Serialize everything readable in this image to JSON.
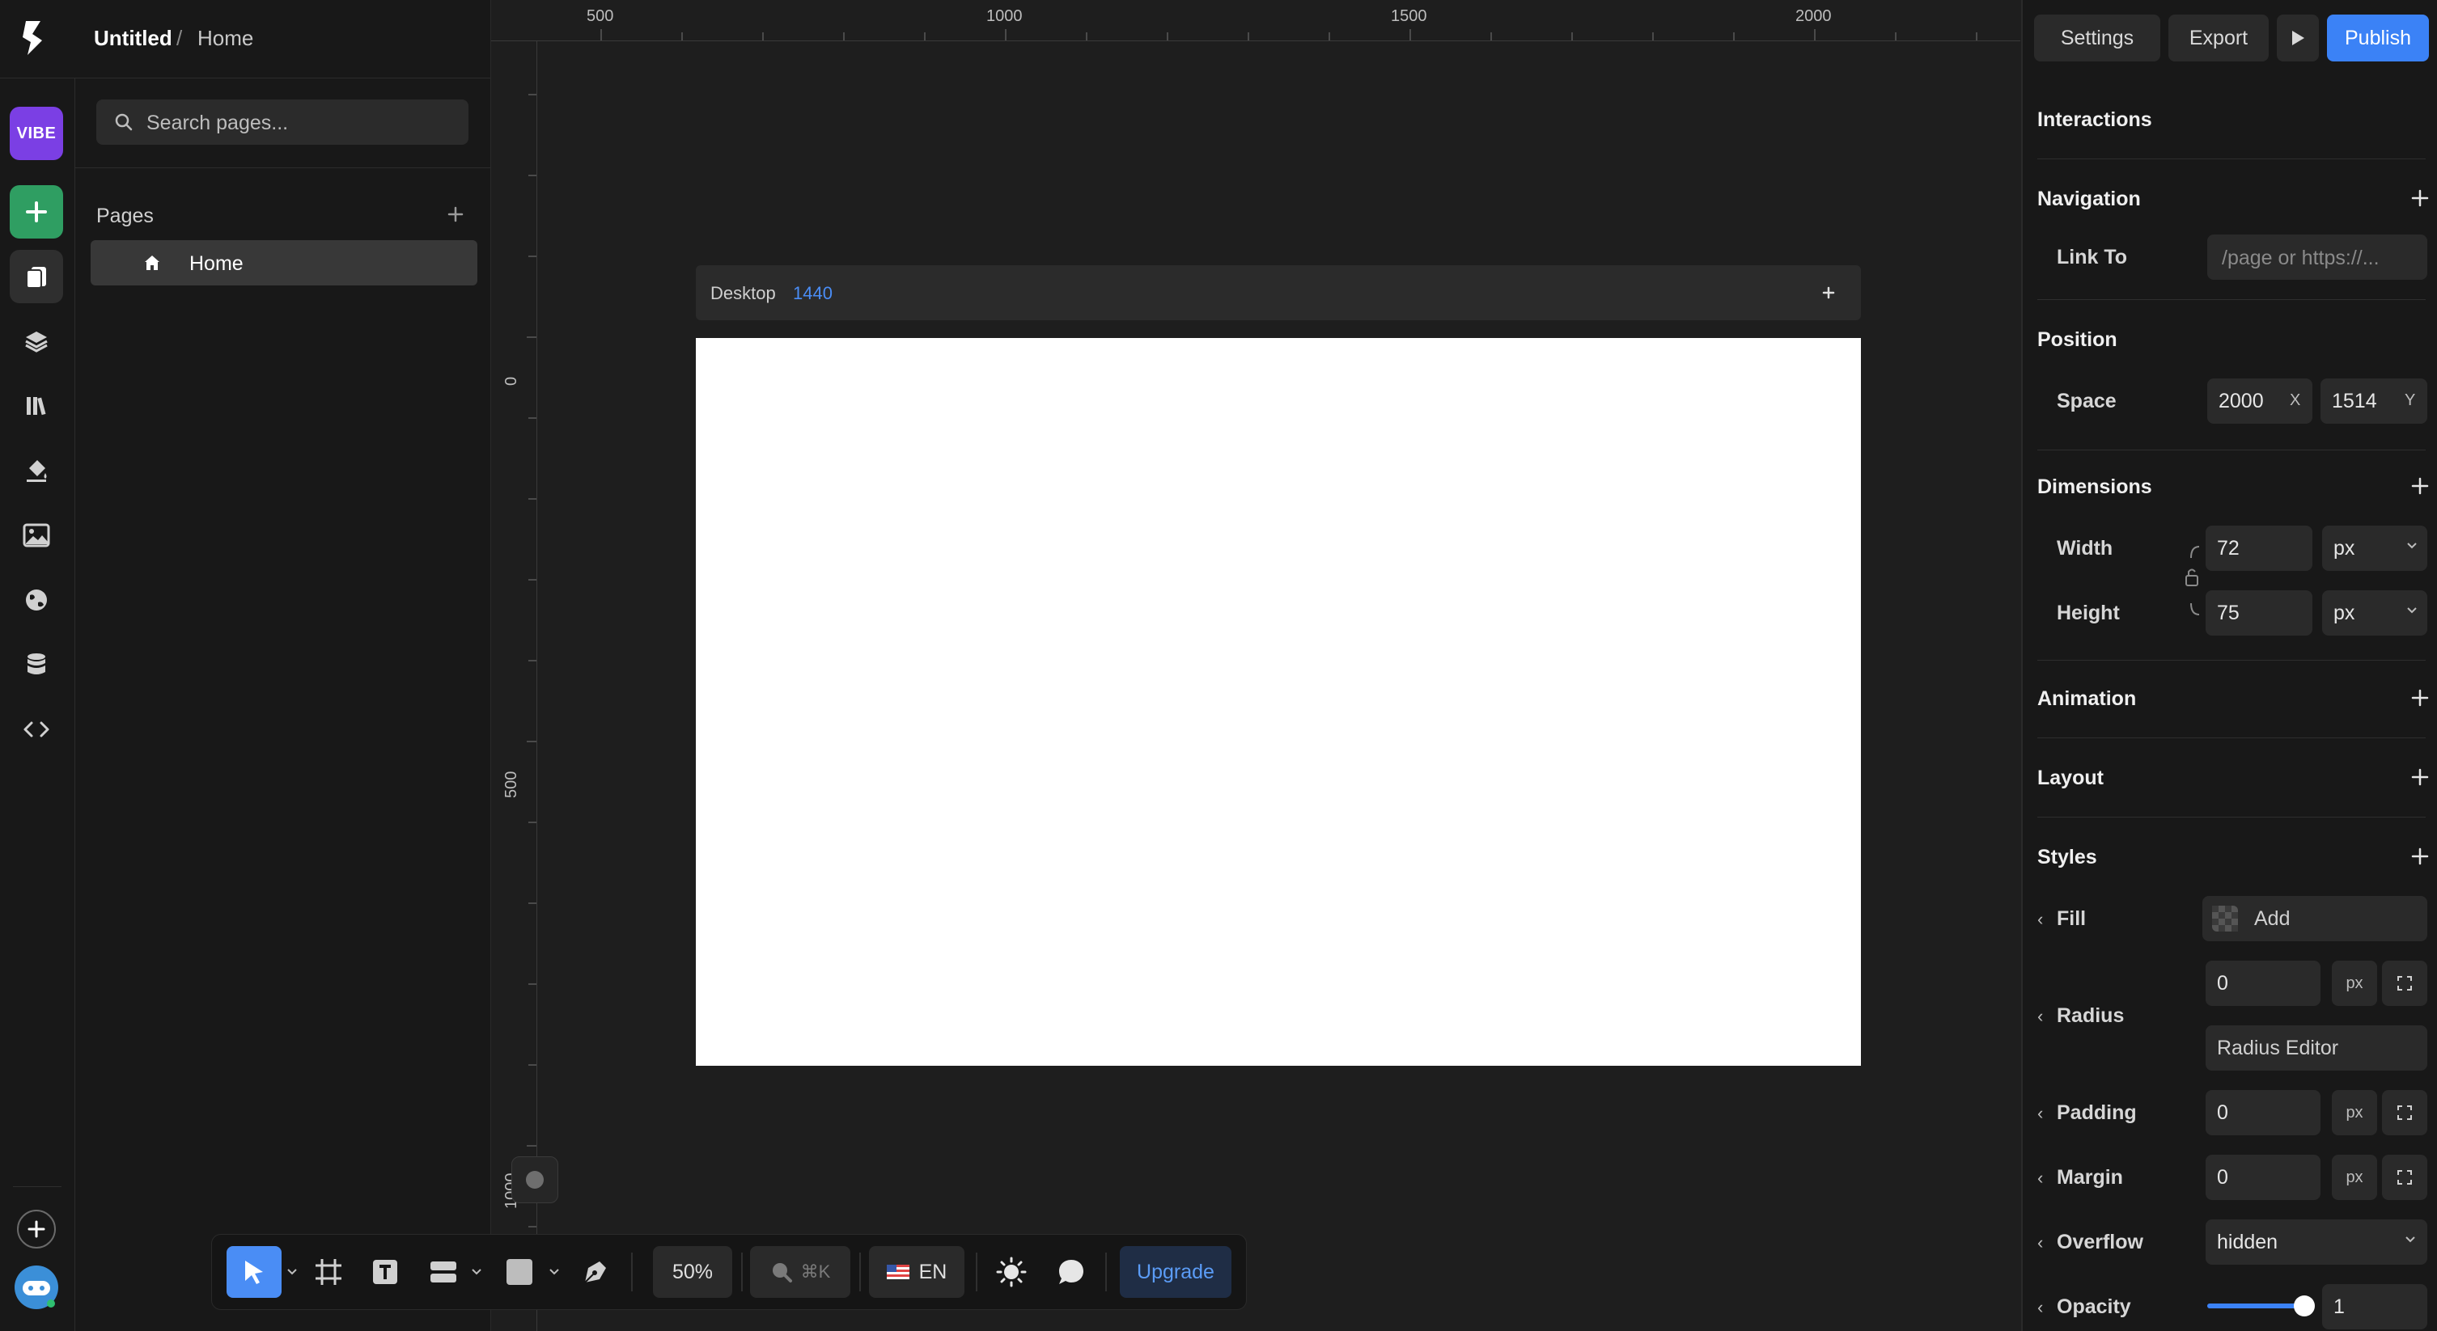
{
  "header": {
    "project_title": "Untitled",
    "separator": "/",
    "current_page": "Home"
  },
  "rail": {
    "vibe_label": "VIBE"
  },
  "pages_panel": {
    "search_placeholder": "Search pages...",
    "section_title": "Pages",
    "pages": [
      {
        "label": "Home"
      }
    ]
  },
  "canvas": {
    "ruler_top_labels": [
      "500",
      "1000",
      "1500",
      "2000"
    ],
    "ruler_left_labels": [
      "0",
      "500",
      "1000"
    ],
    "frame": {
      "device": "Desktop",
      "width": "1440"
    }
  },
  "toolbar": {
    "zoom": "50%",
    "search_shortcut": "⌘K",
    "language": "EN",
    "upgrade_label": "Upgrade"
  },
  "right_panel": {
    "top_buttons": {
      "settings": "Settings",
      "export": "Export",
      "publish": "Publish"
    },
    "interactions_title": "Interactions",
    "navigation": {
      "title": "Navigation",
      "link_label": "Link To",
      "link_placeholder": "/page or https://..."
    },
    "position": {
      "title": "Position",
      "space_label": "Space",
      "x_value": "2000",
      "x_suffix": "X",
      "y_value": "1514",
      "y_suffix": "Y"
    },
    "dimensions": {
      "title": "Dimensions",
      "width_label": "Width",
      "width_value": "72",
      "width_unit": "px",
      "height_label": "Height",
      "height_value": "75",
      "height_unit": "px"
    },
    "animation_title": "Animation",
    "layout_title": "Layout",
    "styles": {
      "title": "Styles",
      "fill_label": "Fill",
      "fill_value": "Add",
      "radius_label": "Radius",
      "radius_value": "0",
      "radius_unit": "px",
      "radius_editor": "Radius Editor",
      "padding_label": "Padding",
      "padding_value": "0",
      "padding_unit": "px",
      "margin_label": "Margin",
      "margin_value": "0",
      "margin_unit": "px",
      "overflow_label": "Overflow",
      "overflow_value": "hidden",
      "opacity_label": "Opacity",
      "opacity_value": "1",
      "opacity_fraction": 1
    }
  },
  "colors": {
    "accent": "#3b82f6",
    "vibe": "#7b3fe4",
    "add_green": "#2f9e62",
    "background": "#1e1e1e",
    "panel": "#181818"
  }
}
